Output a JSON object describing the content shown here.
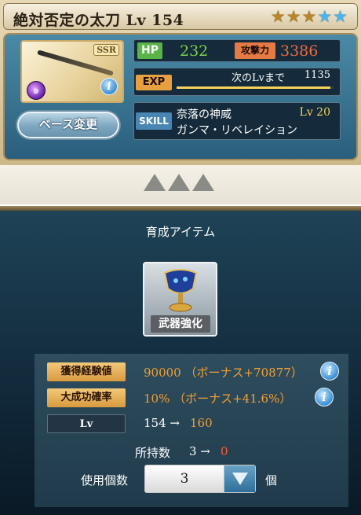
{
  "weapon": {
    "name": "絶対否定の太刀 Lv 154",
    "rarity_badge": "SSR",
    "stars": [
      "gold",
      "gold",
      "gold",
      "blue",
      "blue"
    ],
    "element_icon": "dark-element-icon",
    "info_icon": "i",
    "base_change_label": "ベース変更",
    "hp_label": "HP",
    "hp_value": "232",
    "attack_label": "攻撃力",
    "attack_value": "3386",
    "exp_label": "EXP",
    "next_lv_label": "次のLvまで",
    "next_lv_value": "1135",
    "exp_progress_fraction": 0.98,
    "skill_label": "SKILL",
    "skill_name_1": "奈落の神威",
    "skill_name_2": "ガンマ・リベレイション",
    "skill_lv": "Lv 20"
  },
  "upgrade": {
    "section_title": "育成アイテム",
    "item_label": "武器強化",
    "item_icon": "chalice-icon",
    "exp_label": "獲得経験値",
    "exp_value": "90000 （ボーナス+70877）",
    "success_label": "大成功確率",
    "success_value": "10% （ボーナス+41.6%）",
    "lv_label": "Lv",
    "lv_from": "154 →",
    "lv_to": "160",
    "owned_label": "所持数",
    "owned_from": "3 →",
    "owned_to": "0",
    "use_label": "使用個数",
    "use_value": "3",
    "use_unit": "個",
    "info_icon": "i"
  },
  "colors": {
    "accent_orange": "#f5a030",
    "hp_green": "#7ed04b",
    "attack_red": "#f26a3d",
    "star_gold": "#b9852a",
    "star_blue": "#4fb3ea",
    "panel_dark": "#0f2535"
  }
}
